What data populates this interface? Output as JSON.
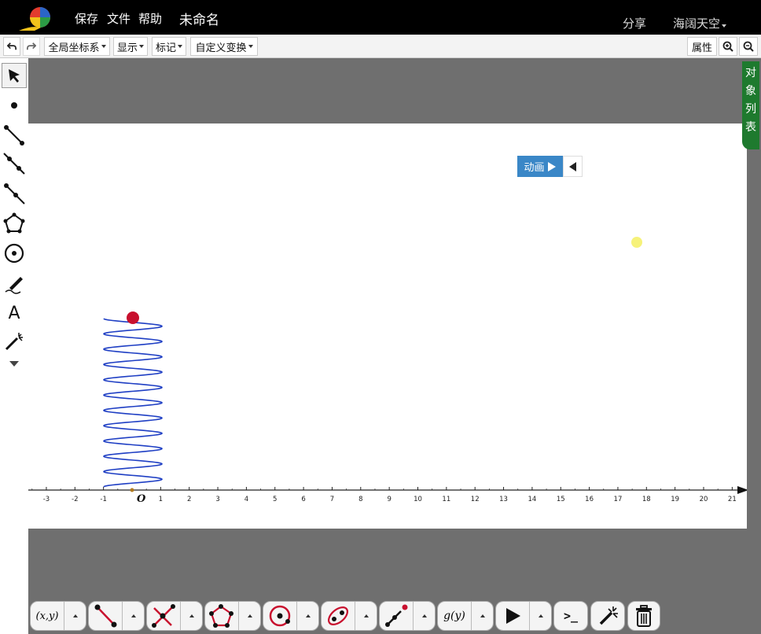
{
  "topbar": {
    "menu": [
      "保存",
      "文件",
      "帮助"
    ],
    "title": "未命名",
    "share": "分享",
    "user": "海阔天空"
  },
  "toolbar": {
    "coord_system": "全局坐标系",
    "display": "显示",
    "mark": "标记",
    "custom_transform": "自定义变换",
    "properties": "属性"
  },
  "left_tools": [
    "select-arrow-icon",
    "point-icon",
    "segment-icon",
    "line-icon",
    "ray-icon",
    "polygon-icon",
    "circle-icon",
    "pen-icon",
    "text-icon",
    "magic-wand-icon",
    "more-tools-icon"
  ],
  "object_tab": [
    "对",
    "象",
    "列",
    "表"
  ],
  "animation": {
    "label": "动画"
  },
  "axis": {
    "origin_label": "O",
    "ticks": [
      "-3",
      "-2",
      "-1",
      "1",
      "2",
      "3",
      "4",
      "5",
      "6",
      "7",
      "8",
      "9",
      "10",
      "11",
      "12",
      "13",
      "14",
      "15",
      "16",
      "17",
      "18",
      "19",
      "20",
      "21"
    ]
  },
  "bottom_tools": [
    {
      "name": "coordinate-tool",
      "label": "(x,y)"
    },
    {
      "name": "segment-tool"
    },
    {
      "name": "intersect-tool"
    },
    {
      "name": "polygon-tool"
    },
    {
      "name": "circle-tool"
    },
    {
      "name": "conic-tool"
    },
    {
      "name": "point-on-object-tool"
    },
    {
      "name": "function-tool",
      "label": "g(y)"
    },
    {
      "name": "animation-tool"
    },
    {
      "name": "command-tool",
      "label": ">_"
    },
    {
      "name": "magic-wand-tool"
    },
    {
      "name": "delete-tool"
    }
  ],
  "colors": {
    "spring": "#1f3fc4",
    "ball": "#c8102e",
    "yellow_point": "#f6f27a",
    "tab_green": "#1e7a2e",
    "anim_blue": "#3a87c7"
  }
}
